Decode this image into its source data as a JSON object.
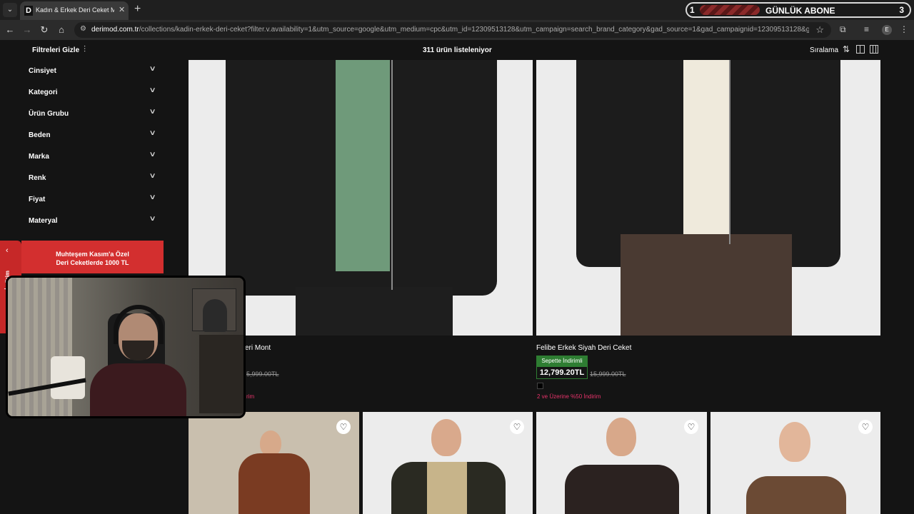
{
  "browser": {
    "tab_title": "Kadın & Erkek Deri Ceket Modelleri",
    "tab_favicon": "D",
    "url_host": "derimod.com.tr",
    "url_path": "/collections/kadin-erkek-deri-ceket?filter.v.availability=1&utm_source=google&utm_medium=cpc&utm_id=12309513128&utm_campaign=search_brand_category&gad_source=1&gad_campaignid=12309513128&gbraid=0AAAA...",
    "avatar_letter": "E"
  },
  "subscriber_goal": {
    "start": "1",
    "label": "GÜNLÜK ABONE",
    "end": "3"
  },
  "toolbar": {
    "filter_toggle": "Filtreleri Gizle",
    "count": "311 ürün listeleniyor",
    "sort": "Sıralama"
  },
  "filters": [
    "Cinsiyet",
    "Kategori",
    "Ürün Grubu",
    "Beden",
    "Marka",
    "Renk",
    "Fiyat",
    "Materyal"
  ],
  "products": [
    {
      "name": "eri Mont",
      "old_price": "5,999.00TL",
      "promo": "rim"
    },
    {
      "name": "Felibe Erkek Siyah Deri Ceket",
      "badge": "Sepette İndirimli",
      "price": "12,799.20TL",
      "old_price": "15,999.00TL",
      "promo": "2 ve Üzerine %50 İndirim"
    }
  ],
  "promo_banner": {
    "line1": "Muhteşem Kasım'a Özel",
    "line2": "Deri Ceketlerde 1000 TL",
    "tag_text": "İndirim"
  },
  "colors": {
    "badge_green": "#2e7d32",
    "promo_pink": "#e8336b",
    "banner_red": "#d32f2f"
  }
}
